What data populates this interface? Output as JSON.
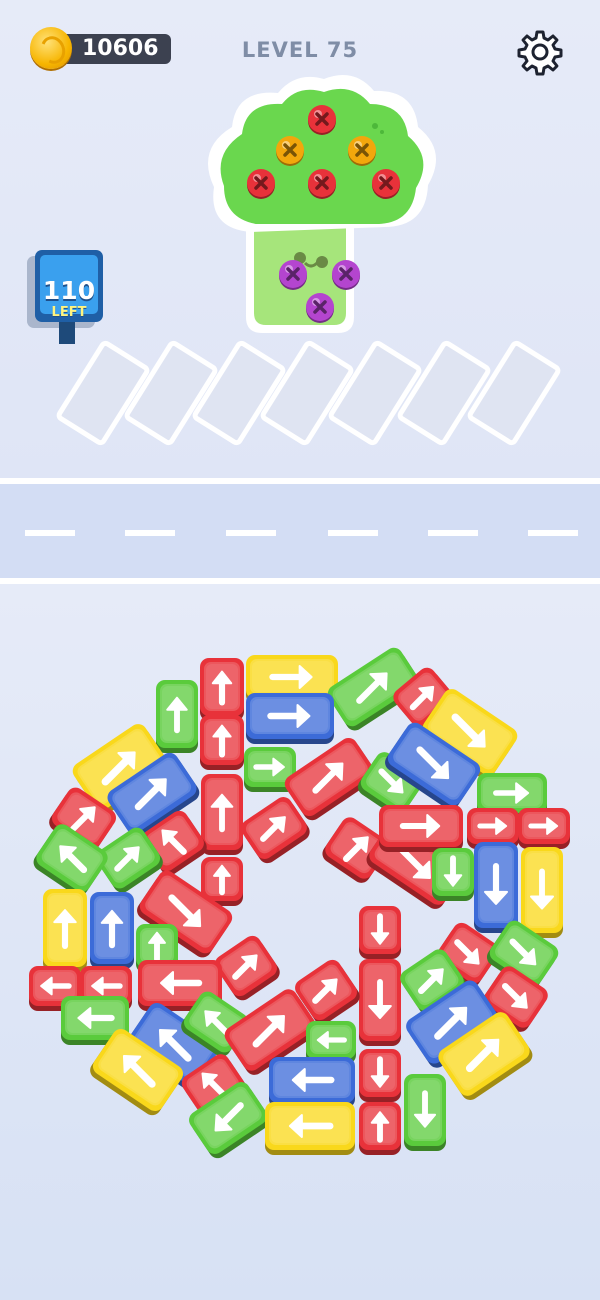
{
  "hud": {
    "coins": "10606",
    "level_label": "LEVEL 75",
    "settings_icon": "gear-icon"
  },
  "queue": {
    "count": "110",
    "label": "LEFT"
  },
  "colors": {
    "red": "#e8323a",
    "yellow": "#f9d81b",
    "blue": "#3c6bd8",
    "green": "#5acb3c",
    "purple": "#b445cf",
    "orange": "#f2a70c"
  },
  "target": {
    "name": "broccoli",
    "screws": [
      "red",
      "orange",
      "orange",
      "red",
      "red",
      "red",
      "purple",
      "purple",
      "purple"
    ]
  },
  "parking": {
    "slots_total": 7,
    "slots_filled": 0
  },
  "cars": [
    {
      "c": "red",
      "d": "up"
    },
    {
      "c": "yellow",
      "d": "right"
    },
    {
      "c": "green",
      "d": "upright"
    },
    {
      "c": "red",
      "d": "upright"
    },
    {
      "c": "green",
      "d": "up"
    },
    {
      "c": "red",
      "d": "up"
    },
    {
      "c": "blue",
      "d": "right"
    },
    {
      "c": "yellow",
      "d": "downright"
    },
    {
      "c": "yellow",
      "d": "upright"
    },
    {
      "c": "blue",
      "d": "upright"
    },
    {
      "c": "green",
      "d": "right"
    },
    {
      "c": "red",
      "d": "upright"
    },
    {
      "c": "green",
      "d": "downright"
    },
    {
      "c": "blue",
      "d": "downright"
    },
    {
      "c": "red",
      "d": "up"
    },
    {
      "c": "red",
      "d": "upright"
    },
    {
      "c": "red",
      "d": "upright"
    },
    {
      "c": "green",
      "d": "right"
    },
    {
      "c": "red",
      "d": "upleft"
    },
    {
      "c": "green",
      "d": "upright"
    },
    {
      "c": "red",
      "d": "upright"
    },
    {
      "c": "red",
      "d": "downright"
    },
    {
      "c": "red",
      "d": "right"
    },
    {
      "c": "red",
      "d": "right"
    },
    {
      "c": "red",
      "d": "right"
    },
    {
      "c": "green",
      "d": "upleft"
    },
    {
      "c": "red",
      "d": "up"
    },
    {
      "c": "green",
      "d": "down"
    },
    {
      "c": "blue",
      "d": "down"
    },
    {
      "c": "yellow",
      "d": "down"
    },
    {
      "c": "yellow",
      "d": "up"
    },
    {
      "c": "blue",
      "d": "up"
    },
    {
      "c": "red",
      "d": "downright"
    },
    {
      "c": "red",
      "d": "down"
    },
    {
      "c": "red",
      "d": "downright"
    },
    {
      "c": "green",
      "d": "downright"
    },
    {
      "c": "green",
      "d": "up"
    },
    {
      "c": "red",
      "d": "upright"
    },
    {
      "c": "red",
      "d": "left"
    },
    {
      "c": "red",
      "d": "left"
    },
    {
      "c": "red",
      "d": "left"
    },
    {
      "c": "red",
      "d": "down"
    },
    {
      "c": "red",
      "d": "upright"
    },
    {
      "c": "green",
      "d": "upright"
    },
    {
      "c": "red",
      "d": "downright"
    },
    {
      "c": "green",
      "d": "left"
    },
    {
      "c": "blue",
      "d": "upleft"
    },
    {
      "c": "green",
      "d": "upleft"
    },
    {
      "c": "red",
      "d": "upright"
    },
    {
      "c": "green",
      "d": "left"
    },
    {
      "c": "blue",
      "d": "upright"
    },
    {
      "c": "yellow",
      "d": "upright"
    },
    {
      "c": "yellow",
      "d": "upleft"
    },
    {
      "c": "red",
      "d": "upleft"
    },
    {
      "c": "blue",
      "d": "left"
    },
    {
      "c": "red",
      "d": "down"
    },
    {
      "c": "green",
      "d": "down"
    },
    {
      "c": "green",
      "d": "downleft"
    },
    {
      "c": "yellow",
      "d": "left"
    },
    {
      "c": "red",
      "d": "up"
    }
  ]
}
